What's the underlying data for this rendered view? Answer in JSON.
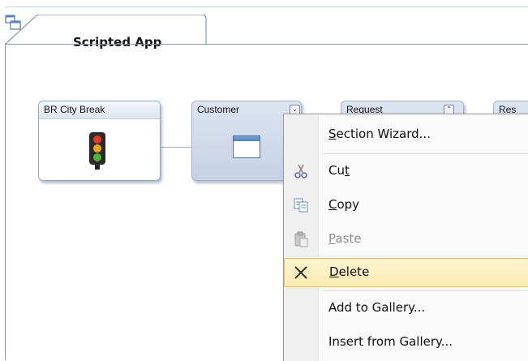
{
  "tab": {
    "title": "Scripted App"
  },
  "nodes": {
    "br": {
      "title": "BR City Break"
    },
    "customer": {
      "title": "Customer"
    },
    "request": {
      "title": "Request"
    },
    "response": {
      "title": "Res"
    }
  },
  "menu": {
    "items": [
      {
        "pre": "",
        "acc": "S",
        "post": "ection Wizard...",
        "icon": "none",
        "disabled": false
      },
      {
        "pre": "Cu",
        "acc": "t",
        "post": "",
        "icon": "scissors-icon",
        "disabled": false
      },
      {
        "pre": "",
        "acc": "C",
        "post": "opy",
        "icon": "copy-icon",
        "disabled": false
      },
      {
        "pre": "",
        "acc": "P",
        "post": "aste",
        "icon": "paste-icon",
        "disabled": true
      },
      {
        "pre": "",
        "acc": "D",
        "post": "elete",
        "icon": "delete-x-icon",
        "disabled": false,
        "highlighted": true
      },
      {
        "pre": "Add to Gallery...",
        "acc": "",
        "post": "",
        "icon": "none",
        "disabled": false
      },
      {
        "pre": "Insert from Gallery...",
        "acc": "",
        "post": "",
        "icon": "none",
        "disabled": false
      }
    ]
  },
  "colors": {
    "menu_highlight": "#fbeab0",
    "node_fill": "#c6d1e6",
    "connector": "#9db1cf"
  }
}
